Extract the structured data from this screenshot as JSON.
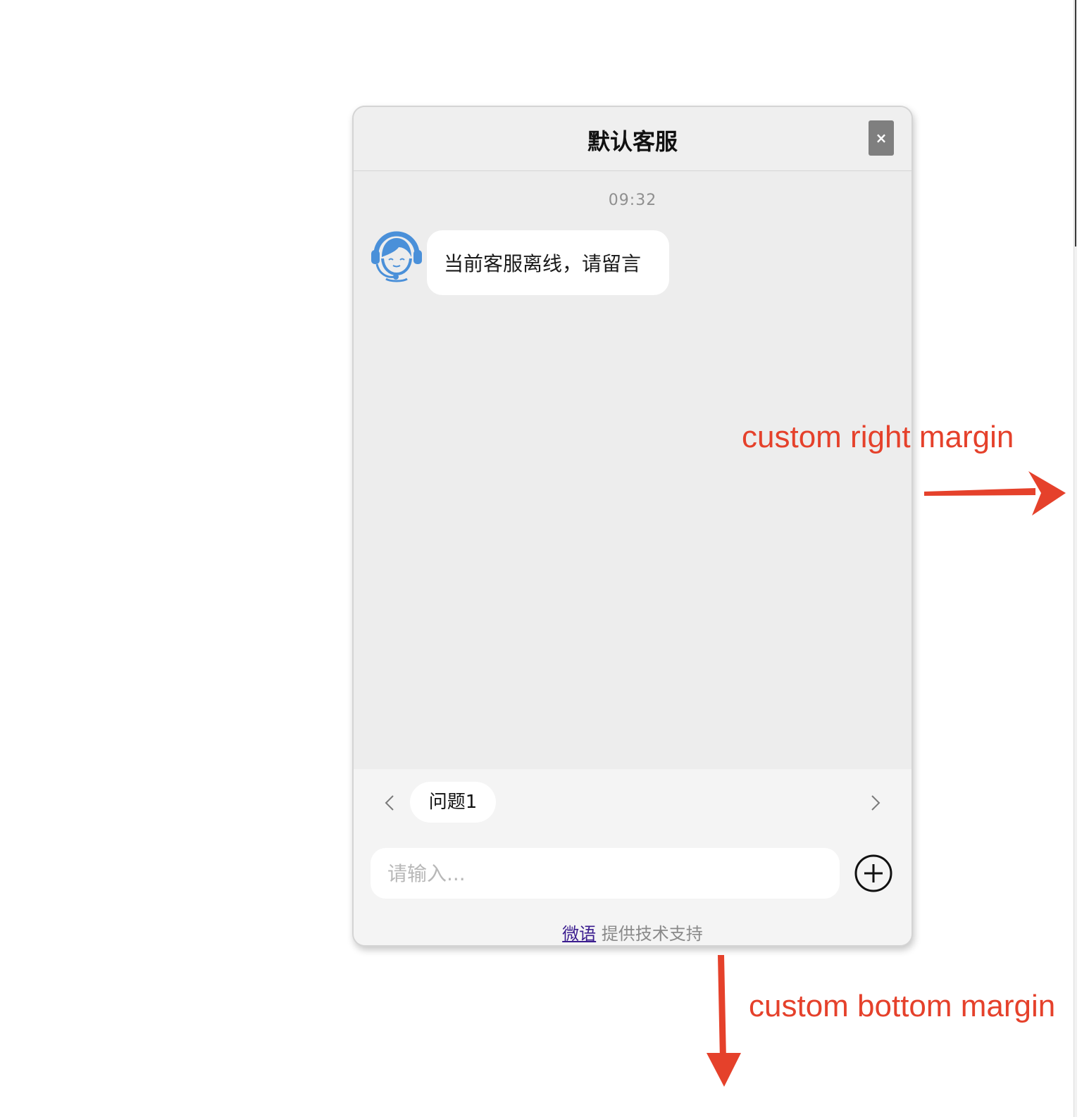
{
  "widget": {
    "title": "默认客服",
    "close_label": "×",
    "timestamp": "09:32",
    "messages": [
      {
        "sender": "agent",
        "avatar_icon": "customer-service-headset-icon",
        "text": "当前客服离线，请留言"
      }
    ],
    "quick_replies": [
      "问题1"
    ],
    "input": {
      "placeholder": "请输入...",
      "value": ""
    },
    "footer": {
      "link_text": "微语",
      "suffix": "提供技术支持"
    },
    "accent_color": "#4a90d9"
  },
  "annotations": {
    "right_margin_label": "custom right margin",
    "bottom_margin_label": "custom bottom margin",
    "color": "#e5412b"
  }
}
